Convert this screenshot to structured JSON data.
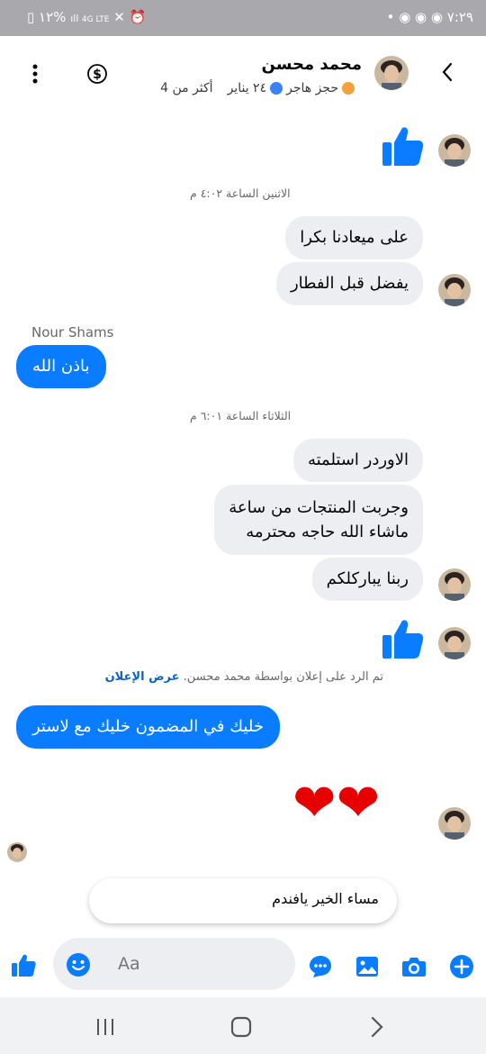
{
  "status_bar": {
    "time": "٧:٢٩",
    "battery": "١٢%",
    "network": "4G LTE"
  },
  "header": {
    "contact_name": "محمد محسن",
    "sub_items": [
      "حجز هاجر",
      "٢٤ يناير",
      "أكثر من 4"
    ],
    "sub_dot_colors": [
      "#f4a13a",
      "#3b82f6"
    ]
  },
  "messages": {
    "ts1": "الاثنين الساعة ٤:٠٢ م",
    "m1": "على ميعادنا بكرا",
    "m2": "يفضل قبل الفطار",
    "sender_name": "Nour Shams",
    "m3": "باذن الله",
    "ts2": "الثلاثاء الساعة ٦:٠١ م",
    "m4": "الاوردر استلمته",
    "m5_line1": "وجربت المنتجات من ساعة",
    "m5_line2": "ماشاء الله حاجه محترمه",
    "m6": "ربنا يباركلكم",
    "ad_reply_text": "تم الرد على إعلان بواسطة محمد محسن.",
    "ad_link": "عرض الإعلان",
    "m7": "خليك في المضمون خليك مع لاستر",
    "hearts": "❤❤"
  },
  "quick_reply": "مساء الخير يافندم",
  "composer": {
    "placeholder": "Aa"
  },
  "colors": {
    "accent": "#0a7cff",
    "bubble_gray": "#eceef1",
    "status_bar": "#a9a9ad"
  }
}
